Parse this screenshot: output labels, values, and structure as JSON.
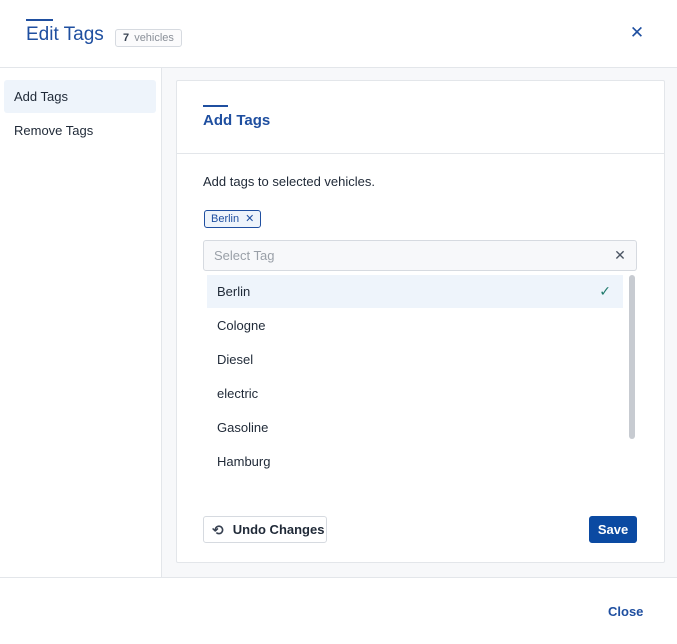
{
  "header": {
    "title": "Edit Tags",
    "badge_count": "7",
    "badge_unit": "vehicles",
    "close_icon": "close-icon"
  },
  "sidebar": {
    "items": [
      {
        "label": "Add Tags",
        "active": true
      },
      {
        "label": "Remove Tags",
        "active": false
      }
    ]
  },
  "section": {
    "title": "Add Tags",
    "description": "Add tags to selected vehicles."
  },
  "selected_tags": [
    "Berlin"
  ],
  "select": {
    "placeholder": "Select Tag",
    "clear_icon": "close-icon"
  },
  "options": [
    {
      "label": "Berlin",
      "selected": true
    },
    {
      "label": "Cologne",
      "selected": false
    },
    {
      "label": "Diesel",
      "selected": false
    },
    {
      "label": "electric",
      "selected": false
    },
    {
      "label": "Gasoline",
      "selected": false
    },
    {
      "label": "Hamburg",
      "selected": false
    }
  ],
  "actions": {
    "undo_label": "Undo Changes",
    "undo_icon": "undo-icon",
    "save_label": "Save"
  },
  "footer": {
    "close_label": "Close"
  },
  "colors": {
    "accent": "#1f4fa0",
    "primary_button": "#0b4aa2",
    "selected_bg": "#eef4fb",
    "check": "#1f7a6b"
  }
}
